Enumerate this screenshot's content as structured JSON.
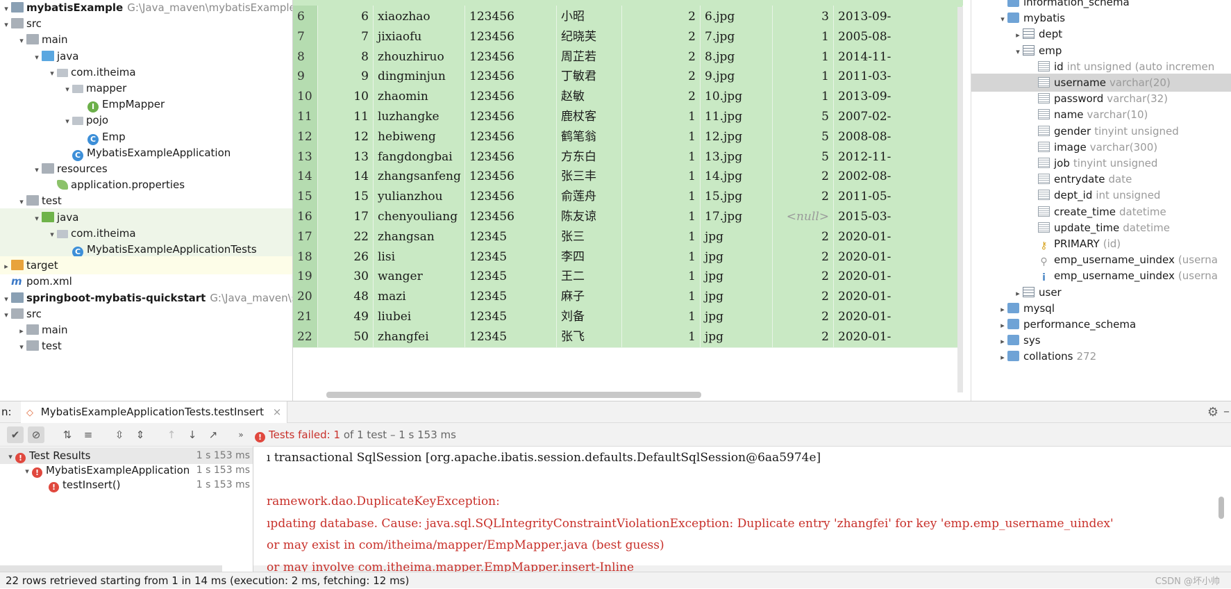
{
  "project_tree": [
    {
      "indent": 0,
      "arrow": "▾",
      "icon": "module",
      "label": "mybatisExample",
      "bold": true,
      "path": "G:\\Java_maven\\mybatisExample"
    },
    {
      "indent": 0,
      "arrow": "▾",
      "icon": "folder",
      "label": "src"
    },
    {
      "indent": 1,
      "arrow": "▾",
      "icon": "folder",
      "label": "main"
    },
    {
      "indent": 2,
      "arrow": "▾",
      "icon": "java-folder",
      "label": "java"
    },
    {
      "indent": 3,
      "arrow": "▾",
      "icon": "package",
      "label": "com.itheima"
    },
    {
      "indent": 4,
      "arrow": "▾",
      "icon": "package",
      "label": "mapper"
    },
    {
      "indent": 5,
      "arrow": "",
      "icon": "interface",
      "label": "EmpMapper"
    },
    {
      "indent": 4,
      "arrow": "▾",
      "icon": "package",
      "label": "pojo"
    },
    {
      "indent": 5,
      "arrow": "",
      "icon": "class",
      "label": "Emp"
    },
    {
      "indent": 4,
      "arrow": "",
      "icon": "class",
      "label": "MybatisExampleApplication"
    },
    {
      "indent": 2,
      "arrow": "▾",
      "icon": "resources-folder",
      "label": "resources"
    },
    {
      "indent": 3,
      "arrow": "",
      "icon": "properties",
      "label": "application.properties"
    },
    {
      "indent": 1,
      "arrow": "▾",
      "icon": "folder",
      "label": "test"
    },
    {
      "indent": 2,
      "arrow": "▾",
      "icon": "test-folder",
      "label": "java",
      "selected": true
    },
    {
      "indent": 3,
      "arrow": "▾",
      "icon": "package",
      "label": "com.itheima",
      "selected": true
    },
    {
      "indent": 4,
      "arrow": "",
      "icon": "class",
      "label": "MybatisExampleApplicationTests",
      "selected": true
    },
    {
      "indent": 0,
      "arrow": "▸",
      "icon": "target-folder",
      "label": "target",
      "target": true
    },
    {
      "indent": 0,
      "arrow": "",
      "icon": "maven",
      "label": "pom.xml"
    },
    {
      "indent": 0,
      "arrow": "▾",
      "icon": "module",
      "label": "springboot-mybatis-quickstart",
      "bold": true,
      "path": "G:\\Java_maven\\springb"
    },
    {
      "indent": 0,
      "arrow": "▾",
      "icon": "folder",
      "label": "src"
    },
    {
      "indent": 1,
      "arrow": "▸",
      "icon": "folder",
      "label": "main"
    },
    {
      "indent": 1,
      "arrow": "▾",
      "icon": "folder",
      "label": "test"
    }
  ],
  "table_rows": [
    [
      "6",
      "6",
      "xiaozhao",
      "123456",
      "小昭",
      "2",
      "6.jpg",
      "3",
      "2013-09-"
    ],
    [
      "7",
      "7",
      "jixiaofu",
      "123456",
      "纪晓芙",
      "2",
      "7.jpg",
      "1",
      "2005-08-"
    ],
    [
      "8",
      "8",
      "zhouzhiruo",
      "123456",
      "周芷若",
      "2",
      "8.jpg",
      "1",
      "2014-11-"
    ],
    [
      "9",
      "9",
      "dingminjun",
      "123456",
      "丁敏君",
      "2",
      "9.jpg",
      "1",
      "2011-03-"
    ],
    [
      "10",
      "10",
      "zhaomin",
      "123456",
      "赵敏",
      "2",
      "10.jpg",
      "1",
      "2013-09-"
    ],
    [
      "11",
      "11",
      "luzhangke",
      "123456",
      "鹿杖客",
      "1",
      "11.jpg",
      "5",
      "2007-02-"
    ],
    [
      "12",
      "12",
      "hebiweng",
      "123456",
      "鹤笔翁",
      "1",
      "12.jpg",
      "5",
      "2008-08-"
    ],
    [
      "13",
      "13",
      "fangdongbai",
      "123456",
      "方东白",
      "1",
      "13.jpg",
      "5",
      "2012-11-"
    ],
    [
      "14",
      "14",
      "zhangsanfeng",
      "123456",
      "张三丰",
      "1",
      "14.jpg",
      "2",
      "2002-08-"
    ],
    [
      "15",
      "15",
      "yulianzhou",
      "123456",
      "俞莲舟",
      "1",
      "15.jpg",
      "2",
      "2011-05-"
    ],
    [
      "16",
      "17",
      "chenyouliang",
      "123456",
      "陈友谅",
      "1",
      "17.jpg",
      "<null>",
      "2015-03-"
    ],
    [
      "17",
      "22",
      "zhangsan",
      "12345",
      "张三",
      "1",
      "jpg",
      "2",
      "2020-01-"
    ],
    [
      "18",
      "26",
      "lisi",
      "12345",
      "李四",
      "1",
      "jpg",
      "2",
      "2020-01-"
    ],
    [
      "19",
      "30",
      "wanger",
      "12345",
      "王二",
      "1",
      "jpg",
      "2",
      "2020-01-"
    ],
    [
      "20",
      "48",
      "mazi",
      "12345",
      "麻子",
      "1",
      "jpg",
      "2",
      "2020-01-"
    ],
    [
      "21",
      "49",
      "liubei",
      "12345",
      "刘备",
      "1",
      "jpg",
      "2",
      "2020-01-"
    ],
    [
      "22",
      "50",
      "zhangfei",
      "12345",
      "张飞",
      "1",
      "jpg",
      "2",
      "2020-01-"
    ]
  ],
  "db_tree": [
    {
      "indent": 0,
      "arrow": "",
      "icon": "schema",
      "label": "information_schema",
      "type": ""
    },
    {
      "indent": 0,
      "arrow": "▾",
      "icon": "schema",
      "label": "mybatis",
      "type": ""
    },
    {
      "indent": 1,
      "arrow": "▸",
      "icon": "table",
      "label": "dept",
      "type": ""
    },
    {
      "indent": 1,
      "arrow": "▾",
      "icon": "table",
      "label": "emp",
      "type": ""
    },
    {
      "indent": 2,
      "arrow": "",
      "icon": "pk-column",
      "label": "id",
      "type": "int unsigned (auto incremen"
    },
    {
      "indent": 2,
      "arrow": "",
      "icon": "column",
      "label": "username",
      "type": "varchar(20)",
      "selected": true
    },
    {
      "indent": 2,
      "arrow": "",
      "icon": "column",
      "label": "password",
      "type": "varchar(32)"
    },
    {
      "indent": 2,
      "arrow": "",
      "icon": "column",
      "label": "name",
      "type": "varchar(10)"
    },
    {
      "indent": 2,
      "arrow": "",
      "icon": "column",
      "label": "gender",
      "type": "tinyint unsigned"
    },
    {
      "indent": 2,
      "arrow": "",
      "icon": "column",
      "label": "image",
      "type": "varchar(300)"
    },
    {
      "indent": 2,
      "arrow": "",
      "icon": "column",
      "label": "job",
      "type": "tinyint unsigned"
    },
    {
      "indent": 2,
      "arrow": "",
      "icon": "column",
      "label": "entrydate",
      "type": "date"
    },
    {
      "indent": 2,
      "arrow": "",
      "icon": "column",
      "label": "dept_id",
      "type": "int unsigned"
    },
    {
      "indent": 2,
      "arrow": "",
      "icon": "column",
      "label": "create_time",
      "type": "datetime"
    },
    {
      "indent": 2,
      "arrow": "",
      "icon": "column",
      "label": "update_time",
      "type": "datetime"
    },
    {
      "indent": 2,
      "arrow": "",
      "icon": "key",
      "label": "PRIMARY",
      "type": "(id)"
    },
    {
      "indent": 2,
      "arrow": "",
      "icon": "index",
      "label": "emp_username_uindex",
      "type": "(userna"
    },
    {
      "indent": 2,
      "arrow": "",
      "icon": "unique",
      "label": "emp_username_uindex",
      "type": "(userna"
    },
    {
      "indent": 1,
      "arrow": "▸",
      "icon": "table",
      "label": "user",
      "type": ""
    },
    {
      "indent": 0,
      "arrow": "▸",
      "icon": "schema",
      "label": "mysql",
      "type": ""
    },
    {
      "indent": 0,
      "arrow": "▸",
      "icon": "schema",
      "label": "performance_schema",
      "type": ""
    },
    {
      "indent": 0,
      "arrow": "▸",
      "icon": "schema",
      "label": "sys",
      "type": ""
    },
    {
      "indent": 0,
      "arrow": "▸",
      "icon": "schema",
      "label": "collations",
      "type": "272"
    }
  ],
  "run": {
    "prefix": "n:",
    "tab_label": "MybatisExampleApplicationTests.testInsert",
    "status_prefix": "Tests failed:",
    "status_count": "1",
    "status_suffix": "of 1 test – 1 s 153 ms"
  },
  "results": [
    {
      "label": "Test Results",
      "time": "1 s 153 ms",
      "indent": 0,
      "arrow": "▾"
    },
    {
      "label": "MybatisExampleApplication",
      "time": "1 s 153 ms",
      "indent": 1,
      "arrow": "▾"
    },
    {
      "label": "testInsert()",
      "time": "1 s 153 ms",
      "indent": 2,
      "arrow": ""
    }
  ],
  "console_lines": [
    {
      "text": "ı transactional SqlSession [org.apache.ibatis.session.defaults.DefaultSqlSession@6aa5974e]",
      "color": "black"
    },
    {
      "text": "",
      "color": "black"
    },
    {
      "text": "ramework.dao.DuplicateKeyException:",
      "color": "red"
    },
    {
      "text": "ıpdating database.  Cause: java.sql.SQLIntegrityConstraintViolationException: Duplicate entry 'zhangfei' for key 'emp.emp_username_uindex'",
      "color": "red"
    },
    {
      "text": "or may exist in com/itheima/mapper/EmpMapper.java (best guess)",
      "color": "red"
    },
    {
      "text": "or may involve com.itheima.mapper.EmpMapper.insert-Inline",
      "color": "red"
    }
  ],
  "status_bar": "22 rows retrieved starting from 1 in 14 ms (execution: 2 ms, fetching: 12 ms)",
  "watermark": "CSDN @坏小帅"
}
